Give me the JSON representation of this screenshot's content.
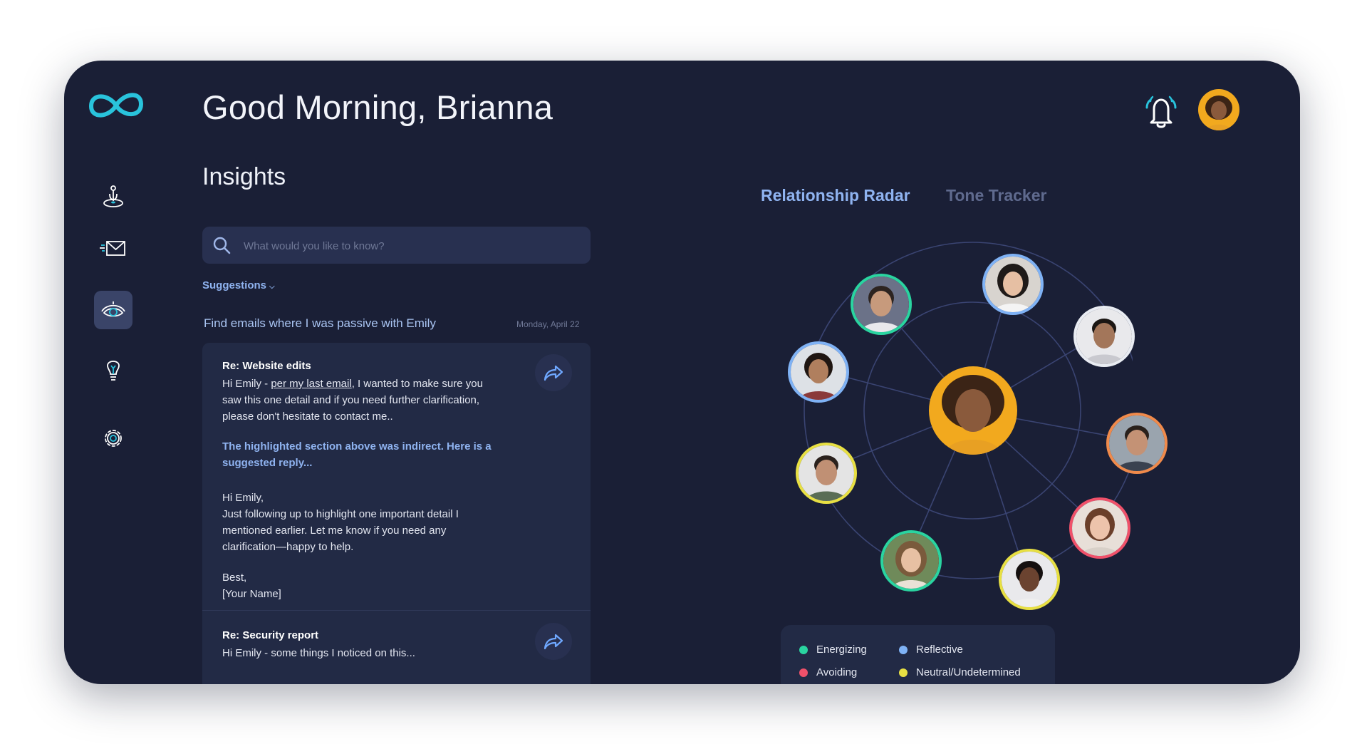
{
  "header": {
    "greeting": "Good Morning, Brianna"
  },
  "section": {
    "title": "Insights"
  },
  "search": {
    "placeholder": "What would you like to know?"
  },
  "suggestions": {
    "label": "Suggestions"
  },
  "query": {
    "text": "Find emails where I was passive with Emily",
    "date": "Monday, April 22"
  },
  "emails": [
    {
      "subject": "Re: Website edits",
      "body_prefix": "Hi Emily - ",
      "body_link": "per my last email",
      "body_rest": ", I wanted to make sure you saw this one detail and if you need further clarification, please don't hesitate to contact me..",
      "hint": "The highlighted section above was indirect. Here is a suggested reply...",
      "reply_greeting": "Hi Emily,",
      "reply_body": "Just following up to highlight one important detail I mentioned earlier. Let me know if you need any clarification—happy to help.",
      "reply_signoff": "Best,",
      "reply_name": "[Your Name]"
    },
    {
      "subject": "Re: Security report",
      "body": "Hi Emily - some things I noticed on this..."
    }
  ],
  "tabs": [
    {
      "label": "Relationship Radar",
      "active": true
    },
    {
      "label": "Tone Tracker",
      "active": false
    }
  ],
  "legend": [
    {
      "label": "Energizing",
      "color": "#2ad4a0"
    },
    {
      "label": "Reflective",
      "color": "#7fb2f5"
    },
    {
      "label": "Avoiding",
      "color": "#f0516a"
    },
    {
      "label": "Neutral/Undetermined",
      "color": "#e8e043"
    }
  ],
  "colors": {
    "background": "#1a1f36",
    "accent": "#8fb3f0",
    "logo": "#29c3dc",
    "energizing": "#2ad4a0",
    "reflective": "#7fb2f5",
    "avoiding": "#f0516a",
    "neutral": "#e8e043",
    "orange": "#f08a4b"
  },
  "icons": {
    "logo": "infinity-logo",
    "notifications": "bell-icon",
    "nav": [
      "joystick-icon",
      "mail-icon",
      "eye-icon",
      "lightbulb-icon",
      "gear-icon"
    ],
    "search": "search-icon",
    "forward": "forward-arrow-icon"
  }
}
